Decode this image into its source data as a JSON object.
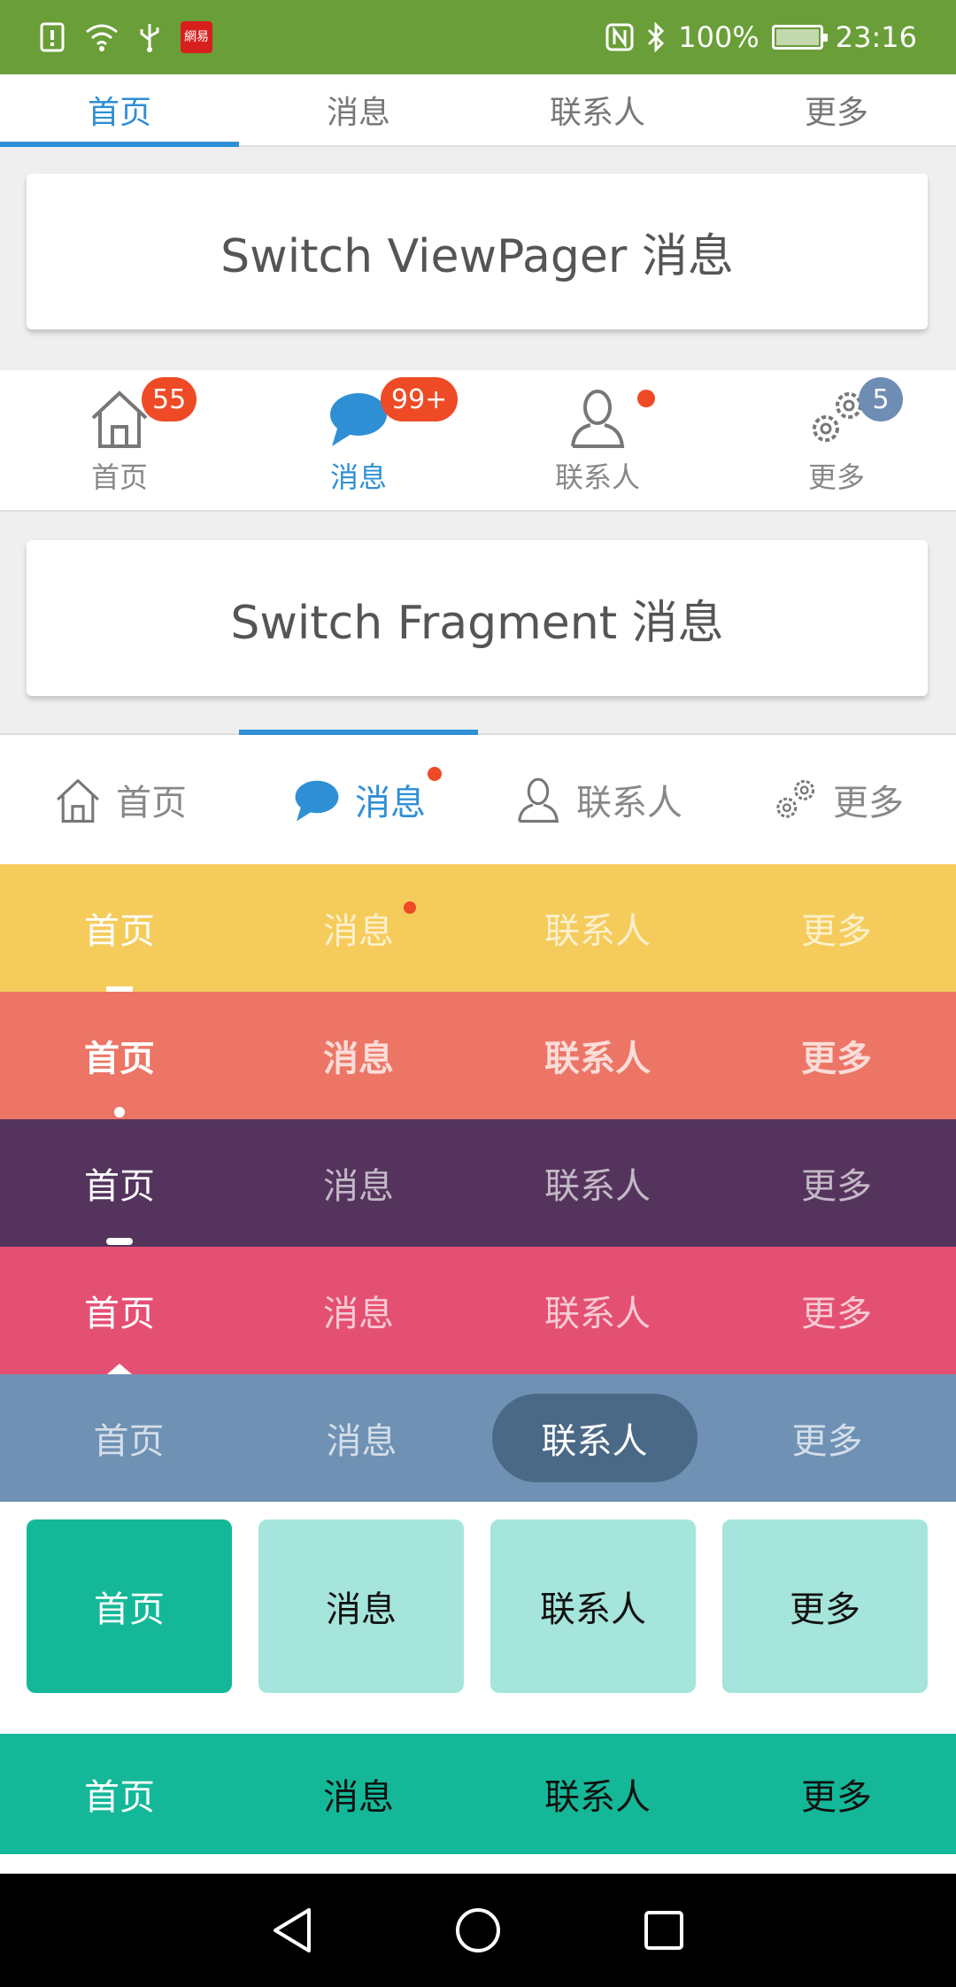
{
  "status_bar": {
    "battery_text": "100%",
    "time": "23:16",
    "news_icon_text": "網易",
    "bg_color": "#6a9e38"
  },
  "tabs": [
    "首页",
    "消息",
    "联系人",
    "更多"
  ],
  "viewpager_tabs": {
    "active_index": 0
  },
  "switch_viewpager_button": "Switch ViewPager 消息",
  "icon_tabs": {
    "active_index": 1,
    "icons": [
      "home-icon",
      "chat-bubble-icon",
      "contact-icon",
      "gear-icon"
    ],
    "badges": [
      "55",
      "99+",
      "",
      "5"
    ],
    "dot_on_index": 2
  },
  "switch_fragment_button": "Switch Fragment 消息",
  "horizontal_tabs": {
    "active_index": 1,
    "dot_on_index": 1
  },
  "color_bars": [
    {
      "color": "#f5cc5c",
      "indicator": "line",
      "active_index": 0,
      "dot_on_index": 1
    },
    {
      "color": "#ec7565",
      "indicator": "dot",
      "active_index": 0
    },
    {
      "color": "#54345c",
      "indicator": "rounded-line",
      "active_index": 0
    },
    {
      "color": "#e45072",
      "indicator": "triangle",
      "active_index": 0
    },
    {
      "color": "#6f91b4",
      "indicator": "pill",
      "active_index": 2
    }
  ],
  "block_tabs": {
    "active_index": 0,
    "active_color": "#14b898",
    "inactive_color": "#a5e5db"
  },
  "teal_tabs": {
    "active_index": 0,
    "color": "#14b898"
  },
  "accent_color": "#2f8fd5",
  "badge_color": "#ef4a26"
}
